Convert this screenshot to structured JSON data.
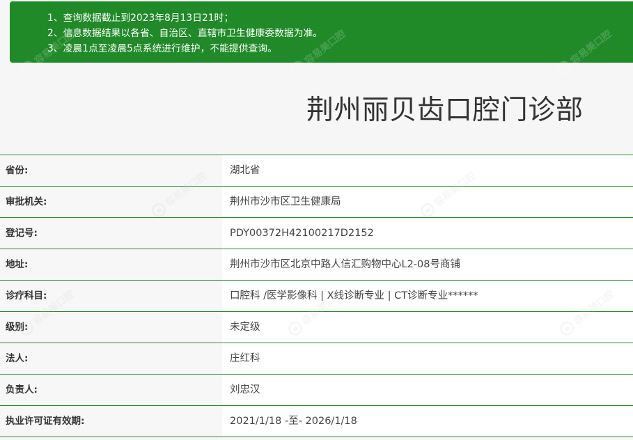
{
  "notice": {
    "lines": [
      "1、查询数据截止到2023年8月13日21时；",
      "2、信息数据结果以各省、自治区、直辖市卫生健康委数据为准。",
      "3、凌晨1点至凌晨5点系统进行维护，不能提供查询。"
    ],
    "background": "#1f8a27"
  },
  "clinic": {
    "name": "荆州丽贝齿口腔门诊部"
  },
  "details": [
    {
      "label": "省份:",
      "value": "湖北省"
    },
    {
      "label": "审批机关:",
      "value": "荆州市沙市区卫生健康局"
    },
    {
      "label": "登记号:",
      "value": "PDY00372H42100217D2152"
    },
    {
      "label": "地址:",
      "value": "荆州市沙市区北京中路人信汇购物中心L2-08号商铺"
    },
    {
      "label": "诊疗科目:",
      "value": "口腔科 /医学影像科  |  X线诊断专业  |  CT诊断专业******"
    },
    {
      "label": "级别:",
      "value": "未定级"
    },
    {
      "label": "法人:",
      "value": "庄红科"
    },
    {
      "label": "负责人:",
      "value": "刘忠汉"
    },
    {
      "label": "执业许可证有效期:",
      "value": "2021/1/18 -至- 2026/1/18"
    }
  ],
  "watermark": {
    "text": "容易美口腔",
    "icon": "tooth-logo-icon"
  },
  "colors": {
    "accent": "#2b8a31",
    "title": "#333333"
  }
}
